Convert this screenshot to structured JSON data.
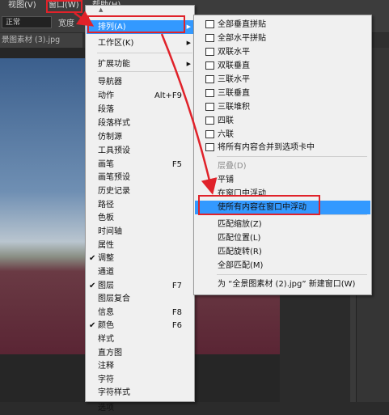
{
  "menubar": {
    "view_label": "视图(V)",
    "window_label": "窗口(W)",
    "help_label": "帮助(H)"
  },
  "options_bar": {
    "mode_value": "正常",
    "width_label": "宽度"
  },
  "document_tab": {
    "label": "景图素材 (3).jpg"
  },
  "window_menu": {
    "items": [
      {
        "label": "排列(A)",
        "submenu": true,
        "highlighted": true
      },
      {
        "label": "工作区(K)",
        "submenu": true
      },
      {
        "label": "扩展功能",
        "submenu": true
      },
      {
        "label": "导航器"
      },
      {
        "label": "动作",
        "shortcut": "Alt+F9"
      },
      {
        "label": "段落"
      },
      {
        "label": "段落样式"
      },
      {
        "label": "仿制源"
      },
      {
        "label": "工具预设"
      },
      {
        "label": "画笔",
        "shortcut": "F5"
      },
      {
        "label": "画笔预设"
      },
      {
        "label": "历史记录"
      },
      {
        "label": "路径"
      },
      {
        "label": "色板"
      },
      {
        "label": "时间轴"
      },
      {
        "label": "属性"
      },
      {
        "label": "调整",
        "checked": true
      },
      {
        "label": "通道"
      },
      {
        "label": "图层",
        "shortcut": "F7",
        "checked": true
      },
      {
        "label": "图层复合"
      },
      {
        "label": "信息",
        "shortcut": "F8"
      },
      {
        "label": "颜色",
        "shortcut": "F6",
        "checked": true
      },
      {
        "label": "样式"
      },
      {
        "label": "直方图"
      },
      {
        "label": "注释"
      },
      {
        "label": "字符"
      },
      {
        "label": "字符样式"
      },
      {
        "label": "选项"
      }
    ],
    "check_mark": "✔"
  },
  "arrange_menu": {
    "items": [
      {
        "label": "全部垂直拼贴",
        "icon": "tile-vertical-icon"
      },
      {
        "label": "全部水平拼贴",
        "icon": "tile-horizontal-icon"
      },
      {
        "label": "双联水平",
        "icon": "two-up-horizontal-icon"
      },
      {
        "label": "双联垂直",
        "icon": "two-up-vertical-icon"
      },
      {
        "label": "三联水平",
        "icon": "three-up-horizontal-icon"
      },
      {
        "label": "三联垂直",
        "icon": "three-up-vertical-icon"
      },
      {
        "label": "三联堆积",
        "icon": "three-up-stacked-icon"
      },
      {
        "label": "四联",
        "icon": "four-up-icon"
      },
      {
        "label": "六联",
        "icon": "six-up-icon"
      },
      {
        "label": "将所有内容合并到选项卡中",
        "icon": "consolidate-tabs-icon"
      },
      {
        "label": "层叠(D)",
        "disabled": true
      },
      {
        "label": "平铺"
      },
      {
        "label": "在窗口中浮动"
      },
      {
        "label": "使所有内容在窗口中浮动",
        "highlighted": true
      },
      {
        "label": "匹配缩放(Z)"
      },
      {
        "label": "匹配位置(L)"
      },
      {
        "label": "匹配旋转(R)"
      },
      {
        "label": "全部匹配(M)"
      },
      {
        "label": "为 “全景图素材 (2).jpg” 新建窗口(W)"
      }
    ]
  },
  "colors": {
    "highlight": "#3399ff",
    "annotation": "#e0222a",
    "menu_bg": "#f0f0f0",
    "app_bg": "#2b2b2b"
  }
}
